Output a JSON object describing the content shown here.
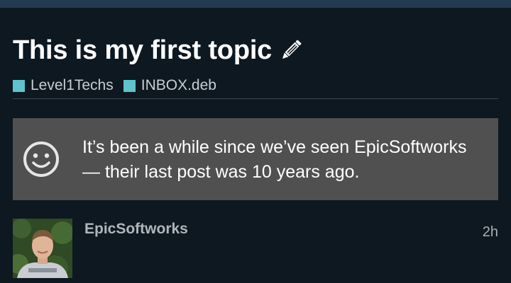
{
  "topic": {
    "title": "This is my first topic",
    "edit_icon": "pencil-icon"
  },
  "categories": [
    {
      "label": "Level1Techs",
      "color": "#5fc3cc"
    },
    {
      "label": "INBOX.deb",
      "color": "#5fc3cc"
    }
  ],
  "notice": {
    "icon": "smiley-icon",
    "text": "It’s been a while since we’ve seen EpicSoftworks — their last post was 10 years ago."
  },
  "post": {
    "username": "EpicSoftworks",
    "time": "2h"
  },
  "colors": {
    "background": "#0d1820",
    "top_bar": "#233a52",
    "category": "#5fc3cc",
    "notice_bg": "#505050"
  }
}
